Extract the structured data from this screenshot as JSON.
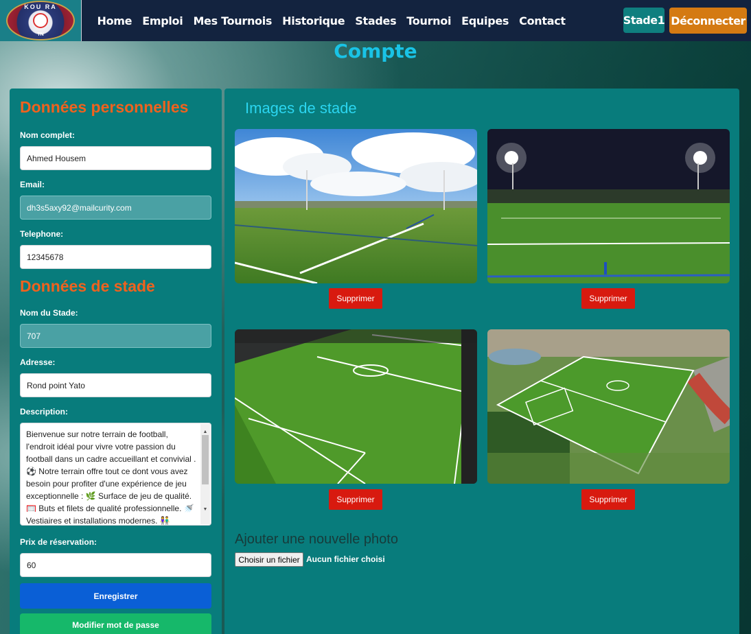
{
  "logo": {
    "text": "KOU RA",
    "sub": "TN"
  },
  "nav": {
    "links": [
      "Home",
      "Emploi",
      "Mes Tournois",
      "Historique",
      "Stades",
      "Tournoi",
      "Equipes",
      "Contact"
    ],
    "stade_button": "Stade1",
    "logout_button": "Déconnecter"
  },
  "page": {
    "title": "Compte"
  },
  "personal": {
    "title": "Données personnelles",
    "name_label": "Nom complet:",
    "name_value": "Ahmed Housem",
    "email_label": "Email:",
    "email_value": "dh3s5axy92@mailcurity.com",
    "phone_label": "Telephone:",
    "phone_value": "12345678"
  },
  "stadium": {
    "title": "Données de stade",
    "name_label": "Nom du Stade:",
    "name_value": "707",
    "address_label": "Adresse:",
    "address_value": "Rond point Yato",
    "description_label": "Description:",
    "description_value": "Bienvenue sur notre terrain de football, l'endroit idéal pour vivre votre passion du football dans un cadre accueillant et convivial .⚽ Notre terrain offre tout ce dont vous avez besoin pour profiter d'une expérience de jeu exceptionnelle : 🌿 Surface de jeu de qualité. 🥅 Buts et filets de qualité professionnelle. 🚿 Vestiaires et installations modernes. 👫",
    "price_label": "Prix de réservation:",
    "price_value": "60",
    "save_button": "Enregistrer",
    "password_button": "Modifier mot de passe"
  },
  "images": {
    "title": "Images de stade",
    "delete_label": "Supprimer",
    "add_title": "Ajouter une nouvelle photo",
    "file_button": "Choisir un fichier",
    "file_status": "Aucun fichier choisi"
  }
}
